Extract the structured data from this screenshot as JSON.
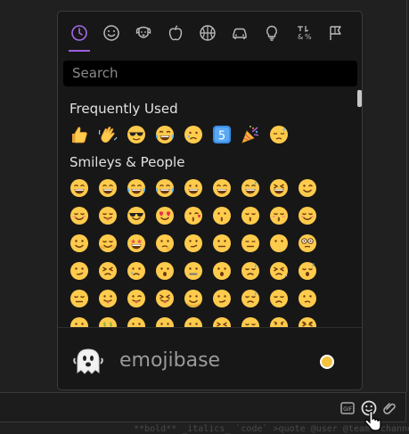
{
  "tabs": [
    {
      "name": "frequently-used",
      "icon": "clock-icon",
      "active": true
    },
    {
      "name": "smileys-people",
      "icon": "smiley-icon"
    },
    {
      "name": "animals-nature",
      "icon": "dog-icon"
    },
    {
      "name": "food-drink",
      "icon": "apple-icon"
    },
    {
      "name": "activity",
      "icon": "basketball-icon"
    },
    {
      "name": "travel-places",
      "icon": "car-icon"
    },
    {
      "name": "objects",
      "icon": "lightbulb-icon"
    },
    {
      "name": "symbols",
      "icon": "symbols-icon"
    },
    {
      "name": "flags",
      "icon": "flag-icon"
    }
  ],
  "search": {
    "placeholder": "Search"
  },
  "categories": {
    "frequent": {
      "title": "Frequently Used"
    },
    "smileys": {
      "title": "Smileys & People"
    }
  },
  "preview": {
    "name": "emojibase"
  },
  "colors": {
    "accent": "#9d5ee0",
    "skin": "#f6c23e"
  }
}
